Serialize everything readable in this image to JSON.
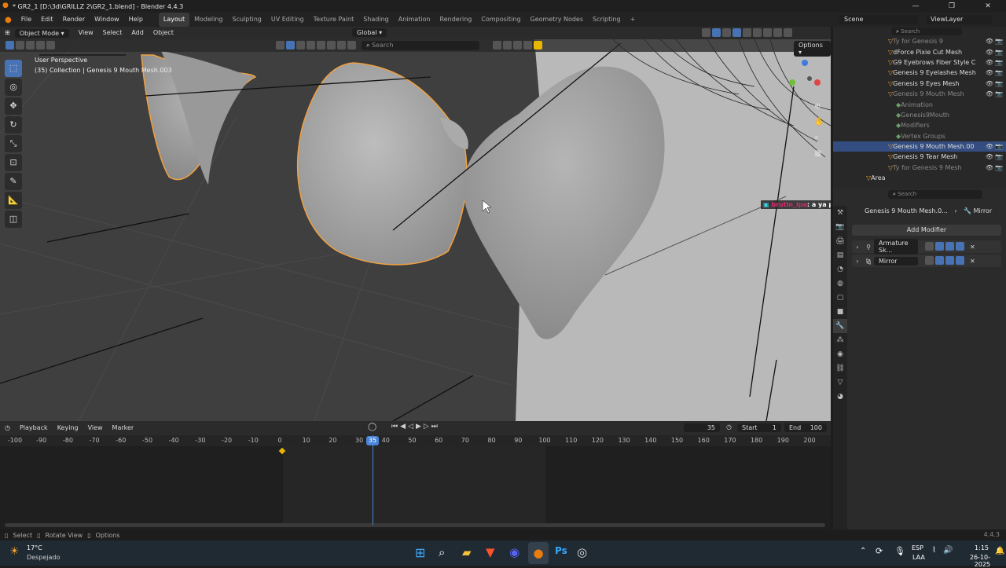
{
  "window": {
    "title": "* GR2_1 [D:\\3d\\GRILLZ 2\\GR2_1.blend] - Blender 4.4.3",
    "controls": [
      "—",
      "❐",
      "✕"
    ]
  },
  "menu": [
    "File",
    "Edit",
    "Render",
    "Window",
    "Help"
  ],
  "workspaces": [
    {
      "label": "Layout",
      "active": true
    },
    {
      "label": "Modeling"
    },
    {
      "label": "Sculpting"
    },
    {
      "label": "UV Editing"
    },
    {
      "label": "Texture Paint"
    },
    {
      "label": "Shading"
    },
    {
      "label": "Animation"
    },
    {
      "label": "Rendering"
    },
    {
      "label": "Compositing"
    },
    {
      "label": "Geometry Nodes"
    },
    {
      "label": "Scripting"
    },
    {
      "label": "+"
    }
  ],
  "scene": {
    "label": "Scene",
    "view_layer": "ViewLayer"
  },
  "viewport_header": {
    "mode": "Object Mode",
    "menus": [
      "View",
      "Select",
      "Add",
      "Object"
    ],
    "orientation": "Global",
    "search_placeholder": "Search",
    "options": "Options"
  },
  "viewport": {
    "info_line1": "User Perspective",
    "info_line2": "(35) Collection | Genesis 9 Mouth Mesh.003",
    "chat_user": "brutin_lpa",
    "chat_text": ": a ya pixula para"
  },
  "outliner": {
    "search_placeholder": "Search",
    "rows": [
      {
        "label": "Ty for Genesis 9",
        "dim": true
      },
      {
        "label": "dForce Pixie Cut Mesh"
      },
      {
        "label": "G9 Eyebrows Fiber Style C"
      },
      {
        "label": "Genesis 9 Eyelashes Mesh"
      },
      {
        "label": "Genesis 9 Eyes Mesh"
      },
      {
        "label": "Genesis 9 Mouth Mesh",
        "dim": true
      },
      {
        "label": "Animation",
        "dim": true,
        "indent": 1
      },
      {
        "label": "Genesis9Mouth",
        "dim": true,
        "indent": 1
      },
      {
        "label": "Modifiers",
        "dim": true,
        "indent": 1
      },
      {
        "label": "Vertex Groups",
        "dim": true,
        "indent": 1
      },
      {
        "label": "Genesis 9 Mouth Mesh.00",
        "selected": true
      },
      {
        "label": "Genesis 9 Tear Mesh"
      },
      {
        "label": "Ty for Genesis 9 Mesh",
        "dim": true
      },
      {
        "label": "Area",
        "outdent": true
      }
    ]
  },
  "properties": {
    "search_placeholder": "Search",
    "breadcrumb_object": "Genesis 9 Mouth Mesh.0...",
    "breadcrumb_modifier": "Mirror",
    "add_modifier": "Add Modifier",
    "modifiers": [
      "Armature Sk...",
      "Mirror"
    ]
  },
  "timeline": {
    "menus": [
      "Playback",
      "Keying",
      "View",
      "Marker"
    ],
    "current_frame": "35",
    "start_label": "Start",
    "start": "1",
    "end_label": "End",
    "end": "100",
    "ticks": [
      "-100",
      "-90",
      "-80",
      "-70",
      "-60",
      "-50",
      "-40",
      "-30",
      "-20",
      "-10",
      "0",
      "10",
      "20",
      "30",
      "40",
      "50",
      "60",
      "70",
      "80",
      "90",
      "100",
      "110",
      "120",
      "130",
      "140",
      "150",
      "160",
      "170",
      "180",
      "190",
      "200"
    ]
  },
  "statusbar": {
    "items": [
      "Select",
      "Rotate View",
      "Options"
    ],
    "version": "4.4.3"
  },
  "taskbar": {
    "weather_temp": "17°C",
    "weather_desc": "Despejado",
    "lang": "ESP",
    "lang2": "LAA",
    "time": "1:15",
    "date": "26-10-2025"
  },
  "colors": {
    "accent": "#4772b3",
    "selection_outline": "#f0a040",
    "playhead": "#4a86d8"
  }
}
